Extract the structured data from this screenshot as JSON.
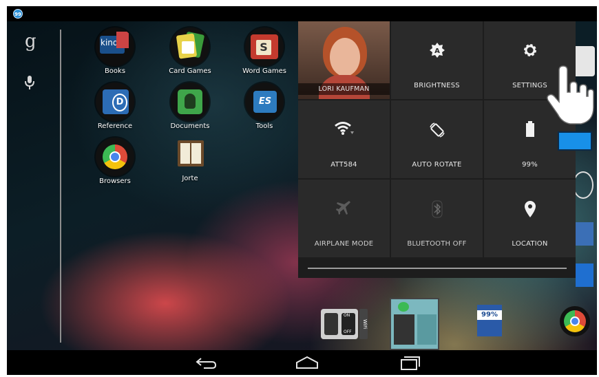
{
  "status_bar": {
    "notification_badge": "99"
  },
  "search": {
    "logo": "g",
    "mic_icon": "mic-icon"
  },
  "apps": [
    {
      "label": "Books",
      "icon": "kindle-icon",
      "icon_text": "kindle"
    },
    {
      "label": "Card Games",
      "icon": "card-games-icon"
    },
    {
      "label": "Word Games",
      "icon": "word-games-icon",
      "icon_text": "S"
    },
    {
      "label": "Reference",
      "icon": "dictionary-icon",
      "icon_text": "D"
    },
    {
      "label": "Documents",
      "icon": "evernote-icon"
    },
    {
      "label": "Tools",
      "icon": "tools-icon",
      "icon_text": "ES"
    },
    {
      "label": "Browsers",
      "icon": "chrome-icon"
    },
    {
      "label": "Jorte",
      "icon": "jorte-icon"
    }
  ],
  "quick_settings": {
    "user": {
      "name": "LORI KAUFMAN"
    },
    "tiles": [
      {
        "label": "BRIGHTNESS",
        "icon": "brightness-auto-icon"
      },
      {
        "label": "SETTINGS",
        "icon": "gear-icon"
      },
      {
        "label": "ATT584",
        "icon": "wifi-icon"
      },
      {
        "label": "AUTO ROTATE",
        "icon": "rotate-icon"
      },
      {
        "label": "99%",
        "icon": "battery-icon"
      },
      {
        "label": "AIRPLANE MODE",
        "icon": "airplane-icon"
      },
      {
        "label": "BLUETOOTH OFF",
        "icon": "bluetooth-icon"
      },
      {
        "label": "LOCATION",
        "icon": "location-pin-icon"
      }
    ]
  },
  "widgets": {
    "wifi_toggle": {
      "on": "ON",
      "off": "OFF",
      "side": "WiFi"
    },
    "battery_widget": {
      "value": "99%"
    }
  },
  "navigation": {
    "back": "back-icon",
    "home": "home-icon",
    "recents": "recents-icon"
  },
  "colors": {
    "tile": "#2a2a2a",
    "panel": "#1d1d1d",
    "accent_blue": "#1890e8"
  }
}
